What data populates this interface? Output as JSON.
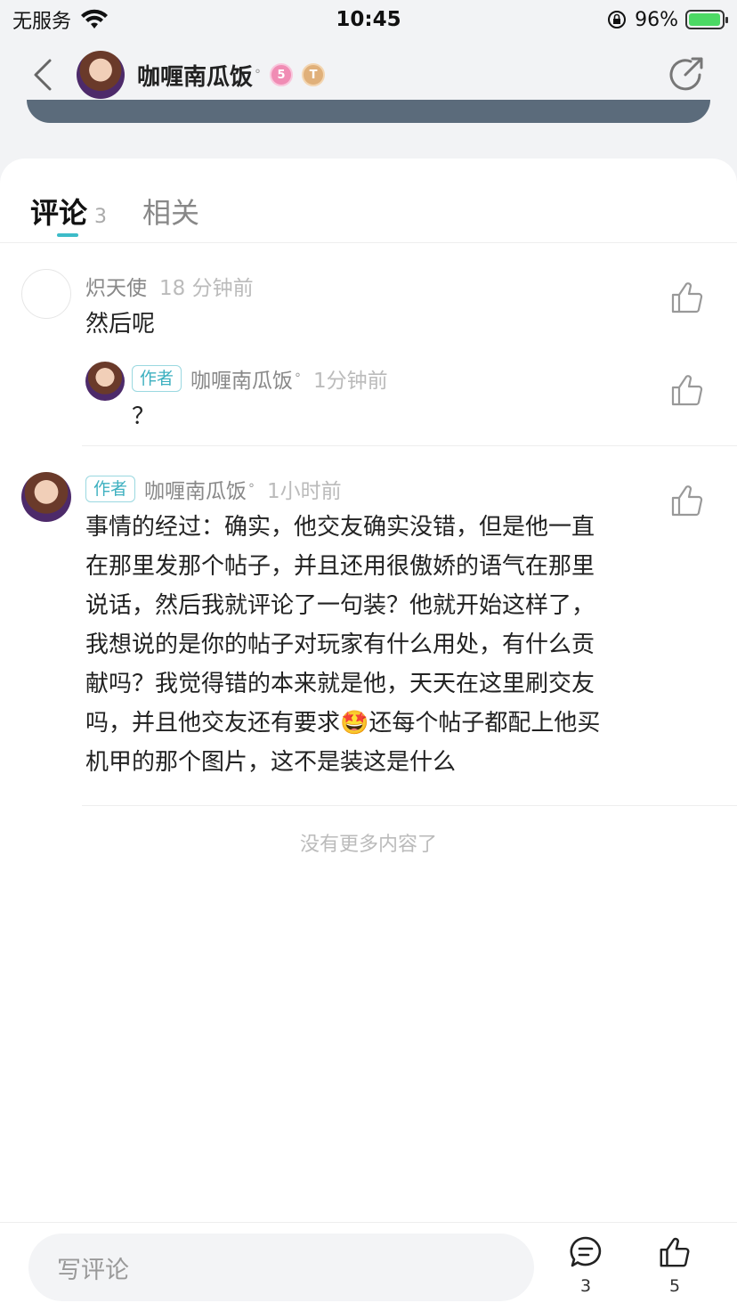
{
  "status_bar": {
    "carrier": "无服务",
    "time": "10:45",
    "battery": "96%",
    "battery_level": 0.96
  },
  "nav": {
    "author_name": "咖喱南瓜饭",
    "badges": [
      "5",
      "T"
    ]
  },
  "tabs": [
    {
      "label": "评论",
      "count": "3"
    },
    {
      "label": "相关"
    }
  ],
  "comments": [
    {
      "name": "炽天使",
      "time": "18 分钟前",
      "text": "然后呢",
      "reply": {
        "tag": "作者",
        "name": "咖喱南瓜饭",
        "time": "1分钟前",
        "text": "？"
      }
    },
    {
      "tag": "作者",
      "name": "咖喱南瓜饭",
      "time": "1小时前",
      "lines": [
        "事情的经过：确实，他交友确实没错，但是他一直",
        "在那里发那个帖子，并且还用很傲娇的语气在那里",
        "说话，然后我就评论了一句装？他就开始这样了，",
        "我想说的是你的帖子对玩家有什么用处，有什么贡",
        "献吗？我觉得错的本来就是他，天天在这里刷交友",
        "吗，并且他交友还有要求🤩还每个帖子都配上他买",
        "机甲的那个图片，这不是装这是什么"
      ]
    }
  ],
  "no_more": "没有更多内容了",
  "bottom_bar": {
    "input_placeholder": "写评论",
    "comment_count": "3",
    "like_count": "5"
  },
  "colors": {
    "accent": "#3dbcc8",
    "author_tag": "#3db0c0"
  }
}
